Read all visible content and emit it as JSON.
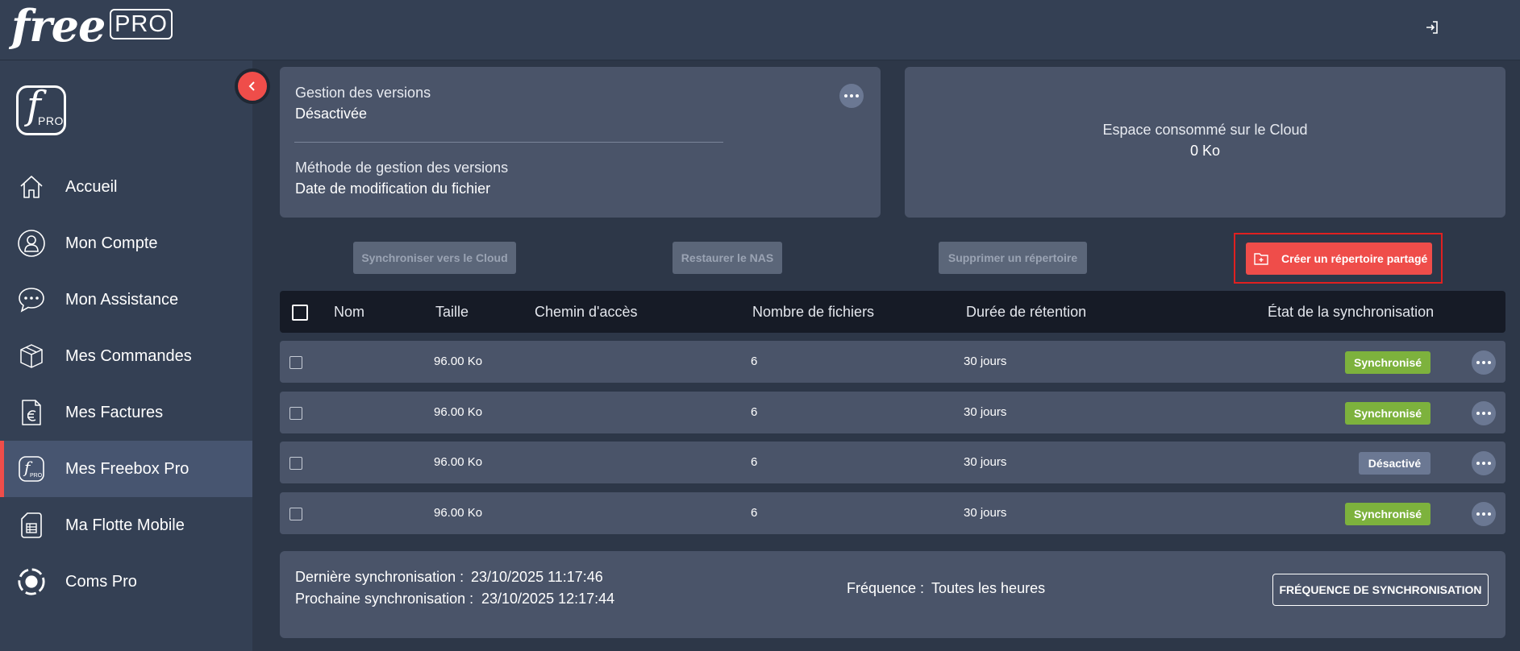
{
  "header": {
    "logo_word": "free",
    "logo_badge": "PRO",
    "logout_icon": "logout-icon"
  },
  "sidebar": {
    "logo_letter": "f",
    "logo_sub": "PRO",
    "items": [
      {
        "label": "Accueil",
        "icon": "home-icon"
      },
      {
        "label": "Mon Compte",
        "icon": "user-icon"
      },
      {
        "label": "Mon Assistance",
        "icon": "chat-icon"
      },
      {
        "label": "Mes Commandes",
        "icon": "box-icon"
      },
      {
        "label": "Mes Factures",
        "icon": "invoice-euro-icon"
      },
      {
        "label": "Mes Freebox Pro",
        "icon": "freebox-pro-icon",
        "active": true
      },
      {
        "label": "Ma Flotte Mobile",
        "icon": "sim-card-icon"
      },
      {
        "label": "Coms Pro",
        "icon": "coms-pro-icon"
      }
    ]
  },
  "versions_card": {
    "versioning_label": "Gestion des versions",
    "versioning_value": "Désactivée",
    "method_label": "Méthode de gestion des versions",
    "method_value": "Date de modification du fichier"
  },
  "space_card": {
    "label": "Espace consommé sur le Cloud",
    "value": "0 Ko"
  },
  "actions": {
    "sync_cloud": "Synchroniser vers le Cloud",
    "restore_nas": "Restaurer le NAS",
    "delete_dir": "Supprimer un répertoire",
    "create_shared": "Créer un répertoire partagé"
  },
  "table": {
    "headers": [
      "Nom",
      "Taille",
      "Chemin d'accès",
      "Nombre de fichiers",
      "Durée de rétention",
      "État de la synchronisation"
    ],
    "rows": [
      {
        "name": "",
        "size": "96.00 Ko",
        "path": "",
        "files": "6",
        "retention": "30 jours",
        "status": "Synchronisé"
      },
      {
        "name": "",
        "size": "96.00 Ko",
        "path": "",
        "files": "6",
        "retention": "30 jours",
        "status": "Synchronisé"
      },
      {
        "name": "",
        "size": "96.00 Ko",
        "path": "",
        "files": "6",
        "retention": "30 jours",
        "status": "Désactivé"
      },
      {
        "name": "",
        "size": "96.00 Ko",
        "path": "",
        "files": "6",
        "retention": "30 jours",
        "status": "Synchronisé"
      }
    ]
  },
  "sync": {
    "last_label": "Dernière synchronisation :",
    "last_value": "23/10/2025 11:17:46",
    "next_label": "Prochaine synchronisation :",
    "next_value": "23/10/2025 12:17:44",
    "freq_label": "Fréquence :",
    "freq_value": "Toutes les heures",
    "freq_button": "FRÉQUENCE DE SYNCHRONISATION"
  },
  "colors": {
    "accent_red": "#ef4d4a",
    "status_green": "#7db23d",
    "status_grey": "#6b7893",
    "background": "#2d3748",
    "card": "#4a5469"
  }
}
